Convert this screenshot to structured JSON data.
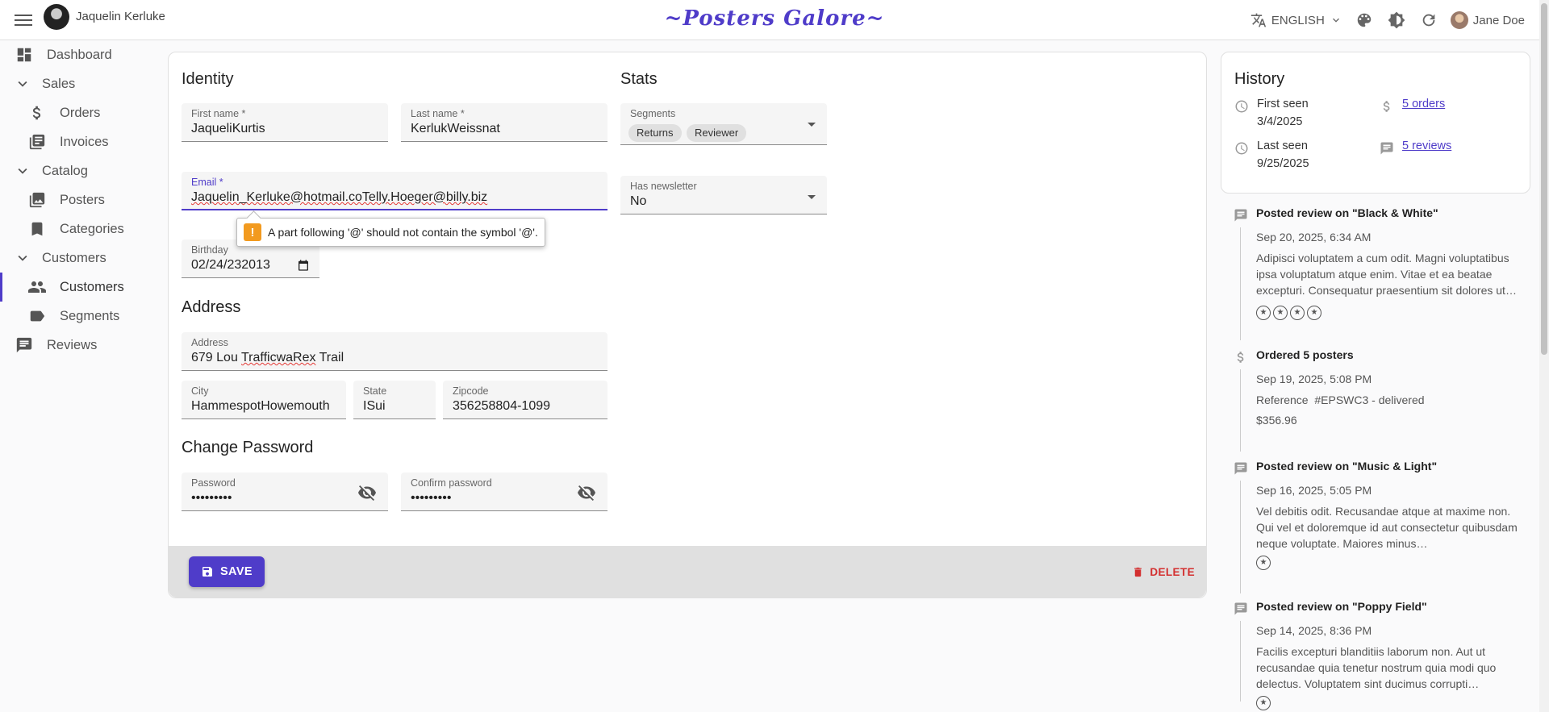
{
  "appbar": {
    "record_title": "Jaquelin Kerluke",
    "brand": "~Posters Galore~",
    "language": "ENGLISH",
    "user_name": "Jane Doe"
  },
  "sidebar": {
    "items": [
      {
        "label": "Dashboard",
        "icon": "dashboard-icon"
      },
      {
        "label": "Sales",
        "icon": "chevron-down-icon"
      },
      {
        "label": "Orders",
        "icon": "dollar-icon"
      },
      {
        "label": "Invoices",
        "icon": "invoices-icon"
      },
      {
        "label": "Catalog",
        "icon": "chevron-down-icon"
      },
      {
        "label": "Posters",
        "icon": "image-icon"
      },
      {
        "label": "Categories",
        "icon": "bookmark-icon"
      },
      {
        "label": "Customers",
        "icon": "chevron-down-icon"
      },
      {
        "label": "Customers",
        "icon": "people-icon"
      },
      {
        "label": "Segments",
        "icon": "label-icon"
      },
      {
        "label": "Reviews",
        "icon": "comment-icon"
      }
    ]
  },
  "identity": {
    "title": "Identity",
    "first_name": {
      "label": "First name *",
      "value": "JaqueliKurtis"
    },
    "last_name": {
      "label": "Last name *",
      "value": "KerlukWeissnat"
    },
    "email": {
      "label": "Email *",
      "value": "Jaquelin_Kerluke@hotmail.coTelly.Hoeger@billy.biz"
    },
    "email_error": "A part following '@' should not contain the symbol '@'.",
    "birthday": {
      "label": "Birthday",
      "value": "02/24/232013"
    }
  },
  "stats": {
    "title": "Stats",
    "segments": {
      "label": "Segments",
      "chips": [
        "Returns",
        "Reviewer"
      ]
    },
    "newsletter": {
      "label": "Has newsletter",
      "value": "No"
    }
  },
  "address": {
    "title": "Address",
    "address": {
      "label": "Address",
      "value_prefix": "679 Lou ",
      "value_misspelled": "TrafficwaRex",
      "value_suffix": " Trail"
    },
    "city": {
      "label": "City",
      "value": "HammespotHowemouth"
    },
    "state": {
      "label": "State",
      "value": "ISui"
    },
    "zipcode": {
      "label": "Zipcode",
      "value": "356258804-1099"
    }
  },
  "password": {
    "title": "Change Password",
    "password": {
      "label": "Password",
      "value": "•••••••••"
    },
    "confirm": {
      "label": "Confirm password",
      "value": "•••••••••"
    }
  },
  "actions": {
    "save": "SAVE",
    "delete": "DELETE"
  },
  "history": {
    "title": "History",
    "first_seen_label": "First seen",
    "first_seen": "3/4/2025",
    "last_seen_label": "Last seen",
    "last_seen": "9/25/2025",
    "orders_link": "5 orders",
    "reviews_link": "5 reviews"
  },
  "events": [
    {
      "title": "Posted review on \"Black & White\"",
      "date": "Sep 20, 2025, 6:34 AM",
      "body": "Adipisci voluptatem a cum odit. Magni voluptatibus ipsa voluptatum atque enim. Vitae et ea beatae excepturi. Consequatur praesentium sit dolores ut…",
      "rating": 4
    },
    {
      "title": "Ordered 5 posters",
      "date": "Sep 19, 2025, 5:08 PM",
      "reference_label": "Reference",
      "reference": "#EPSWC3 - delivered",
      "total": "$356.96"
    },
    {
      "title": "Posted review on \"Music & Light\"",
      "date": "Sep 16, 2025, 5:05 PM",
      "body": "Vel debitis odit. Recusandae atque at maxime non. Qui vel et doloremque id aut consectetur quibusdam neque voluptate. Maiores minus…",
      "rating": 1
    },
    {
      "title": "Posted review on \"Poppy Field\"",
      "date": "Sep 14, 2025, 8:36 PM",
      "body": "Facilis excepturi blanditiis laborum non. Aut ut recusandae quia tenetur nostrum quia modi quo delectus. Voluptatem sint ducimus corrupti…",
      "rating": 1
    }
  ],
  "colors": {
    "primary": "#4f3cc9",
    "danger": "#d32f2f",
    "warning": "#f29a1f"
  }
}
